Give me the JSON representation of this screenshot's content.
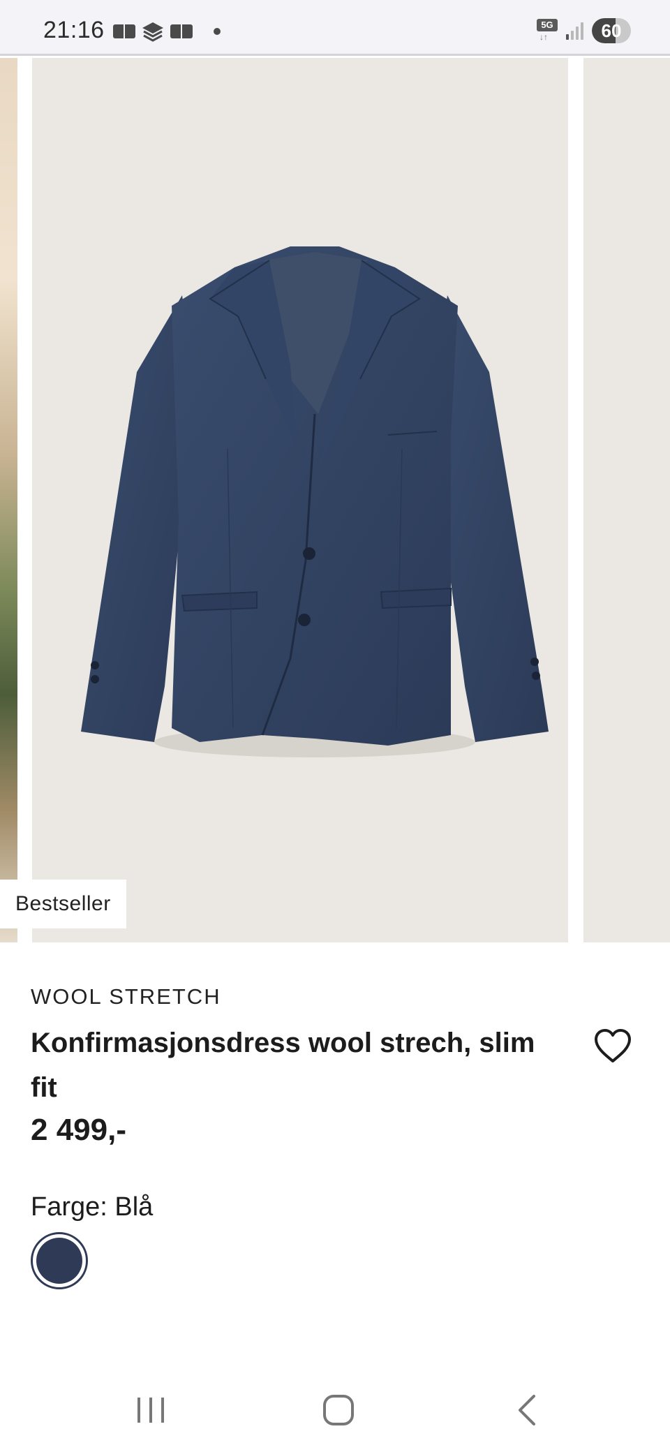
{
  "status_bar": {
    "time": "21:16",
    "network": "5G",
    "battery": "60",
    "battery_level": 0.6,
    "signal_bars_on": 1,
    "signal_bars_total": 4
  },
  "carousel": {
    "badge": "Bestseller",
    "product_image": "navy-blazer-image",
    "image_background": "#ebe8e3"
  },
  "product": {
    "brand": "WOOL STRETCH",
    "title": "Konfirmasjonsdress wool strech, slim fit",
    "price": "2 499,-",
    "color_label": "Farge: Blå",
    "swatches": [
      {
        "name": "Blå",
        "color": "#2f3a56",
        "selected": true
      }
    ]
  },
  "icons": {
    "favorite": "heart-outline-icon"
  },
  "nav": {
    "recent": "recent-apps-icon",
    "home": "home-icon",
    "back": "back-icon"
  }
}
